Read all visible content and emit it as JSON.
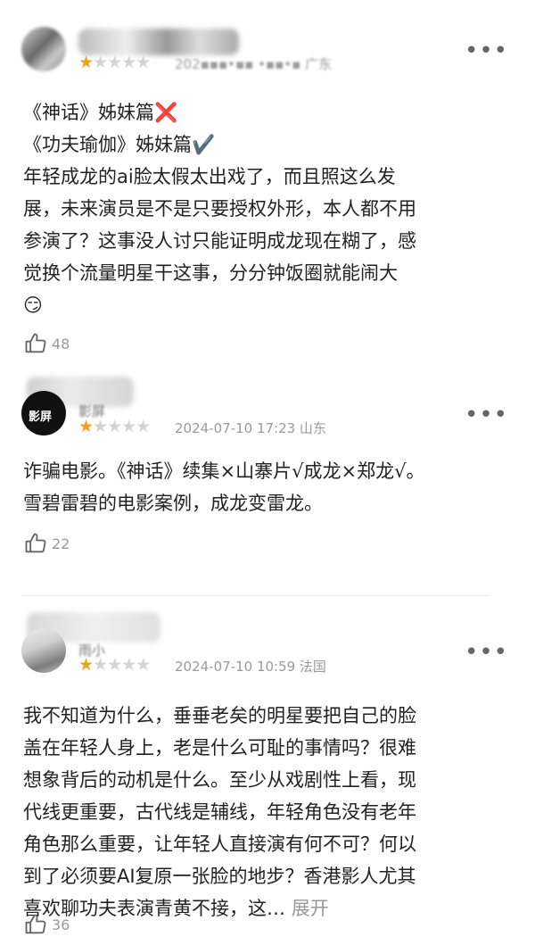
{
  "reviews": [
    {
      "username": "· ' ․ · ▪ • ' ▪▪",
      "rating": 1,
      "meta": "202▪▪▪•▪▪ •▪▪•▪ 广东",
      "lines": [
        "《神话》姊妹篇",
        "《功夫瑜伽》姊妹篇",
        "年轻成龙的ai脸太假太出戏了，而且照这么发",
        "展，未来演员是不是只要授权外形，本人都不用",
        "参演了？这事没人讨只能证明成龙现在糊了，感",
        "觉换个流量明星干这事，分分钟饭圈就能闹大",
        "😏"
      ],
      "emoji_x": "❌",
      "emoji_check": "✔️",
      "likes": "48"
    },
    {
      "username": "影屏",
      "avatar_text": "影屏",
      "rating": 1,
      "meta": "2024-07-10 17:23 山东",
      "lines": [
        "诈骗电影。《神话》续集×山寨片√成龙×郑龙√。",
        "雪碧雷碧的电影案例，成龙变雷龙。"
      ],
      "likes": "22"
    },
    {
      "username": "雨小",
      "rating": 1,
      "meta": "2024-07-10 10:59 法国",
      "lines": [
        "我不知道为什么，垂垂老矣的明星要把自己的脸",
        "盖在年轻人身上，老是什么可耻的事情吗？很难",
        "想象背后的动机是什么。至少从戏剧性上看，现",
        "代线更重要，古代线是辅线，年轻角色没有老年",
        "角色那么重要，让年轻人直接演有何不可？何以",
        "到了必须要AI复原一张脸的地步？香港影人尤其",
        "喜欢聊功夫表演青黄不接，这…"
      ],
      "expand_label": "展开",
      "likes": "36"
    }
  ],
  "more_glyph": "•••",
  "colors": {
    "star_on": "#f0a020",
    "star_off": "#d4d4d4",
    "meta": "#9a9a9a"
  },
  "icons": {
    "like": "thumbs-up-icon",
    "more": "more-dots-icon"
  }
}
